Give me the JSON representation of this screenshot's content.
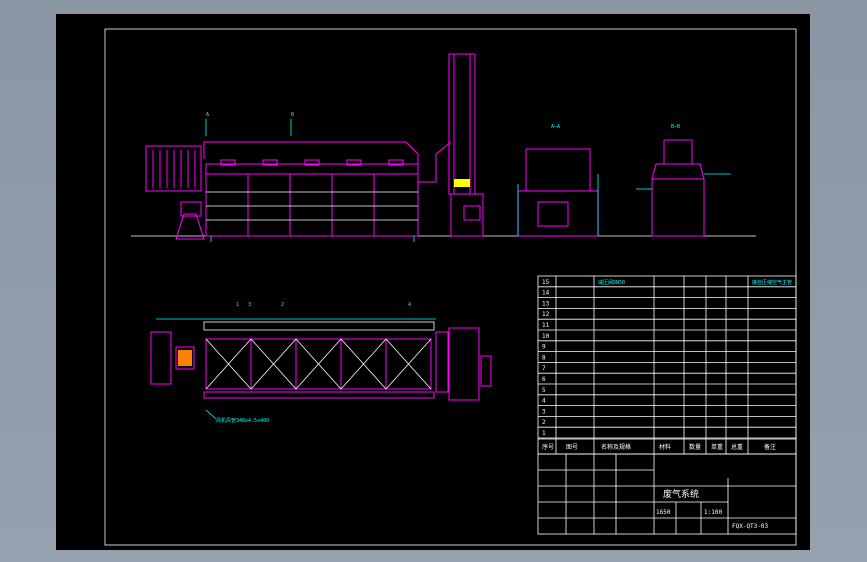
{
  "drawing": {
    "title_block": {
      "drawing_name": "废气系统",
      "drawing_number": "FQX-QT3-03",
      "scale": "1:100",
      "weight": "1650"
    },
    "elevation_views": {
      "section_aa": "A—A",
      "section_bb": "B—B",
      "marker_a": "A",
      "marker_b": "B"
    },
    "plan_view": {
      "balloons": [
        "1",
        "2",
        "3",
        "4"
      ],
      "note": "风机风管348x4.5x400"
    },
    "bom": {
      "headers": [
        "序号",
        "图号",
        "名称及规格",
        "材料",
        "数量",
        "单重",
        "总重",
        "备注"
      ],
      "rows": [
        [
          "15",
          "",
          "减压阀DN50",
          "",
          "",
          "",
          "",
          "接自压缩空气主管"
        ],
        [
          "14",
          "",
          "",
          "",
          "",
          "",
          "",
          ""
        ],
        [
          "13",
          "",
          "",
          "",
          "",
          "",
          "",
          ""
        ],
        [
          "12",
          "",
          "",
          "",
          "",
          "",
          "",
          ""
        ],
        [
          "11",
          "",
          "",
          "",
          "",
          "",
          "",
          ""
        ],
        [
          "10",
          "",
          "",
          "",
          "",
          "",
          "",
          ""
        ],
        [
          "9",
          "",
          "",
          "",
          "",
          "",
          "",
          ""
        ],
        [
          "8",
          "",
          "",
          "",
          "",
          "",
          "",
          ""
        ],
        [
          "7",
          "",
          "",
          "",
          "",
          "",
          "",
          ""
        ],
        [
          "6",
          "",
          "",
          "",
          "",
          "",
          "",
          ""
        ],
        [
          "5",
          "",
          "",
          "",
          "",
          "",
          "",
          ""
        ],
        [
          "4",
          "",
          "",
          "",
          "",
          "",
          "",
          ""
        ],
        [
          "3",
          "",
          "",
          "",
          "",
          "",
          "",
          ""
        ],
        [
          "2",
          "",
          "",
          "",
          "",
          "",
          "",
          ""
        ],
        [
          "1",
          "",
          "",
          "",
          "",
          "",
          "",
          ""
        ]
      ]
    }
  }
}
